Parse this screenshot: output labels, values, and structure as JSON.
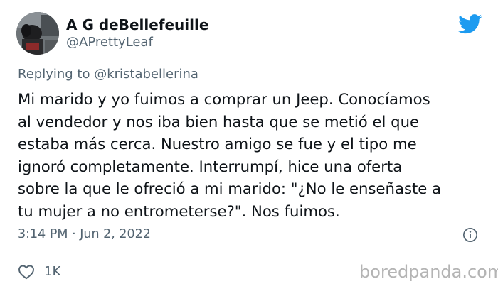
{
  "author": {
    "display_name": "A G deBellefeuille",
    "handle": "@APrettyLeaf",
    "avatar_icon": "profile-photo-avatar"
  },
  "header": {
    "brand_icon": "twitter-bird-icon",
    "brand_color": "#1d9bf0"
  },
  "reply": {
    "prefix": "Replying to",
    "mention": "@kristabellerina"
  },
  "body": {
    "lines": [
      "Mi marido y yo fuimos a comprar un Jeep. Conocíamos",
      "al vendedor y nos iba bien hasta que se metió el que",
      "estaba más cerca. Nuestro amigo se fue y el tipo me",
      "ignoró completamente. Interrumpí, hice una oferta",
      "sobre la que le ofreció a mi marido: \"¿No le enseñaste a",
      "tu mujer a no entrometerse?\". Nos fuimos."
    ]
  },
  "meta": {
    "timestamp": "3:14 PM · Jun 2, 2022",
    "info_icon": "info-icon"
  },
  "actions": {
    "like_icon": "heart-icon",
    "like_count": "1K"
  },
  "watermark": {
    "text": "boredpanda.com"
  },
  "colors": {
    "text_primary": "#0f1419",
    "text_secondary": "#536471",
    "divider": "#cfd9de",
    "watermark": "#b4b4b4"
  }
}
